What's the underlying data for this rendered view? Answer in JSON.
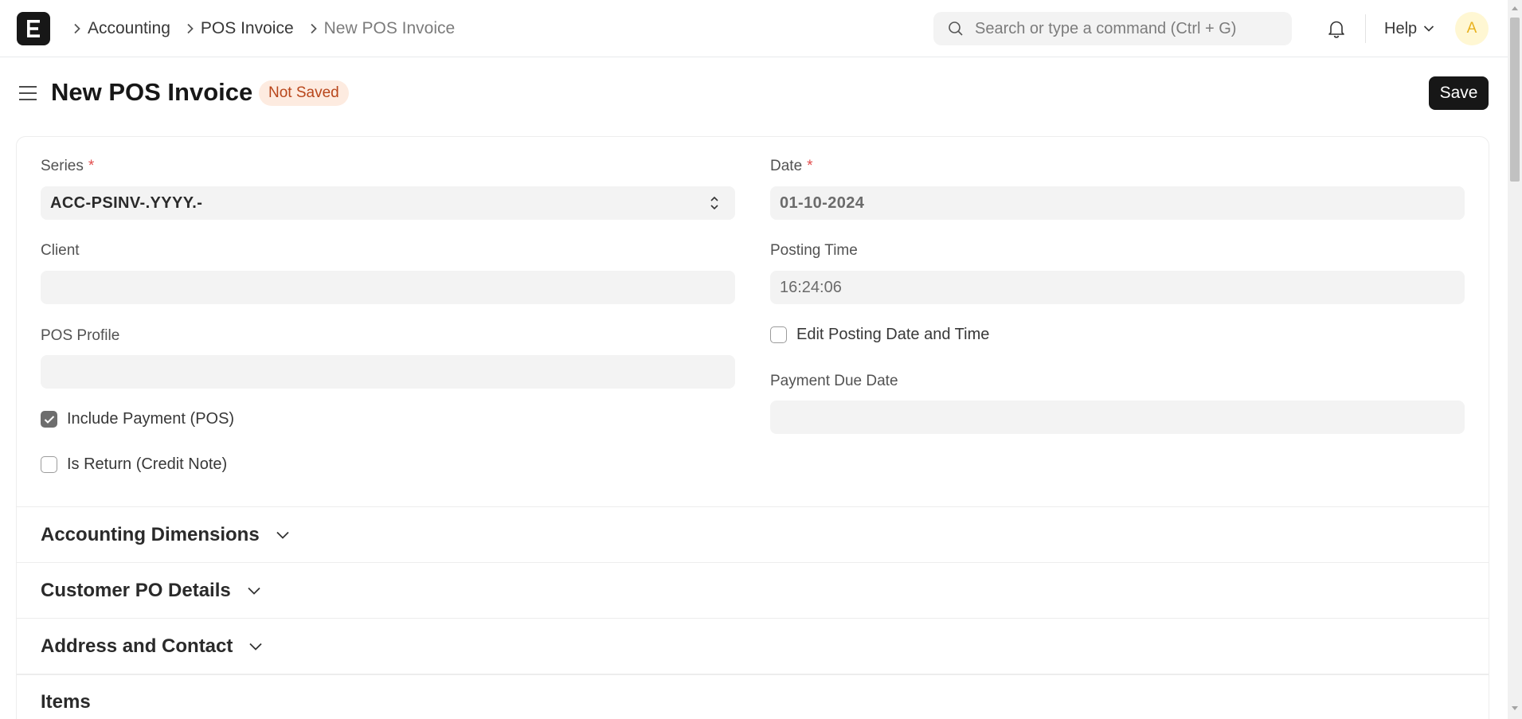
{
  "navbar": {
    "logo_letter": "E",
    "breadcrumbs": [
      "Accounting",
      "POS Invoice",
      "New POS Invoice"
    ],
    "search_placeholder": "Search or type a command (Ctrl + G)",
    "help_label": "Help",
    "avatar_initial": "A"
  },
  "page": {
    "title": "New POS Invoice",
    "status": "Not Saved",
    "save_label": "Save"
  },
  "form": {
    "left": {
      "series_label": "Series",
      "series_value": "ACC-PSINV-.YYYY.-",
      "client_label": "Client",
      "client_value": "",
      "pos_profile_label": "POS Profile",
      "pos_profile_value": "",
      "include_payment_label": "Include Payment (POS)",
      "include_payment_checked": true,
      "is_return_label": "Is Return (Credit Note)",
      "is_return_checked": false
    },
    "right": {
      "date_label": "Date",
      "date_value": "01-10-2024",
      "posting_time_label": "Posting Time",
      "posting_time_value": "16:24:06",
      "edit_posting_label": "Edit Posting Date and Time",
      "edit_posting_checked": false,
      "payment_due_label": "Payment Due Date",
      "payment_due_value": ""
    },
    "required_mark": "*"
  },
  "sections": [
    {
      "title": "Accounting Dimensions",
      "collapsible": true
    },
    {
      "title": "Customer PO Details",
      "collapsible": true
    },
    {
      "title": "Address and Contact",
      "collapsible": true
    },
    {
      "title": "Items",
      "collapsible": false
    }
  ],
  "colors": {
    "primary_button": "#171717",
    "badge_bg": "#fdebe0",
    "badge_text": "#b8461b",
    "required": "#e24c4c",
    "avatar_bg": "#fff7d3",
    "avatar_text": "#e8b11e"
  }
}
